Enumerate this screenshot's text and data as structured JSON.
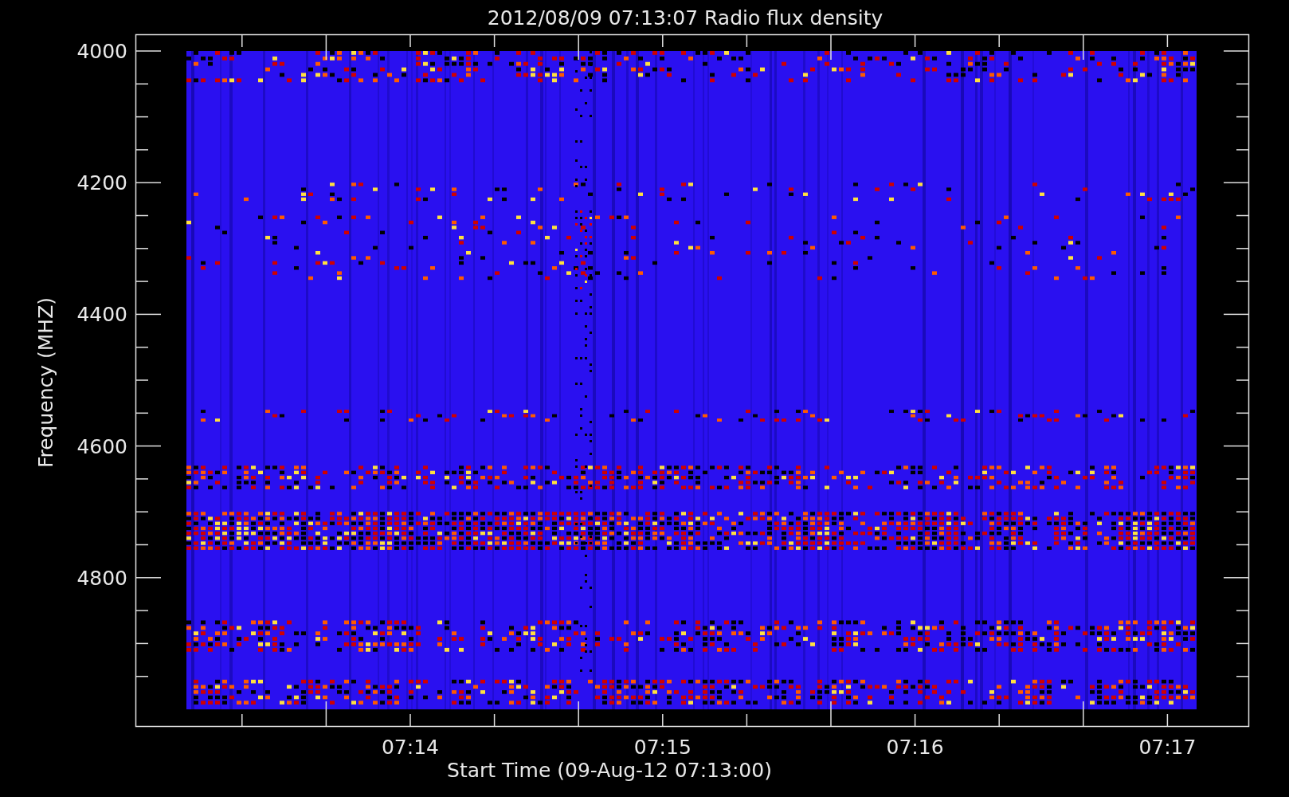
{
  "title": "2012/08/09 07:13:07 Radio flux density",
  "y_axis": {
    "label": "Frequency (MHZ)",
    "ticks": [
      "4000",
      "4200",
      "4400",
      "4600",
      "4800"
    ]
  },
  "x_axis": {
    "label": "Start Time (09-Aug-12 07:13:00)",
    "ticks": [
      "07:14",
      "07:15",
      "07:16",
      "07:17"
    ]
  }
}
